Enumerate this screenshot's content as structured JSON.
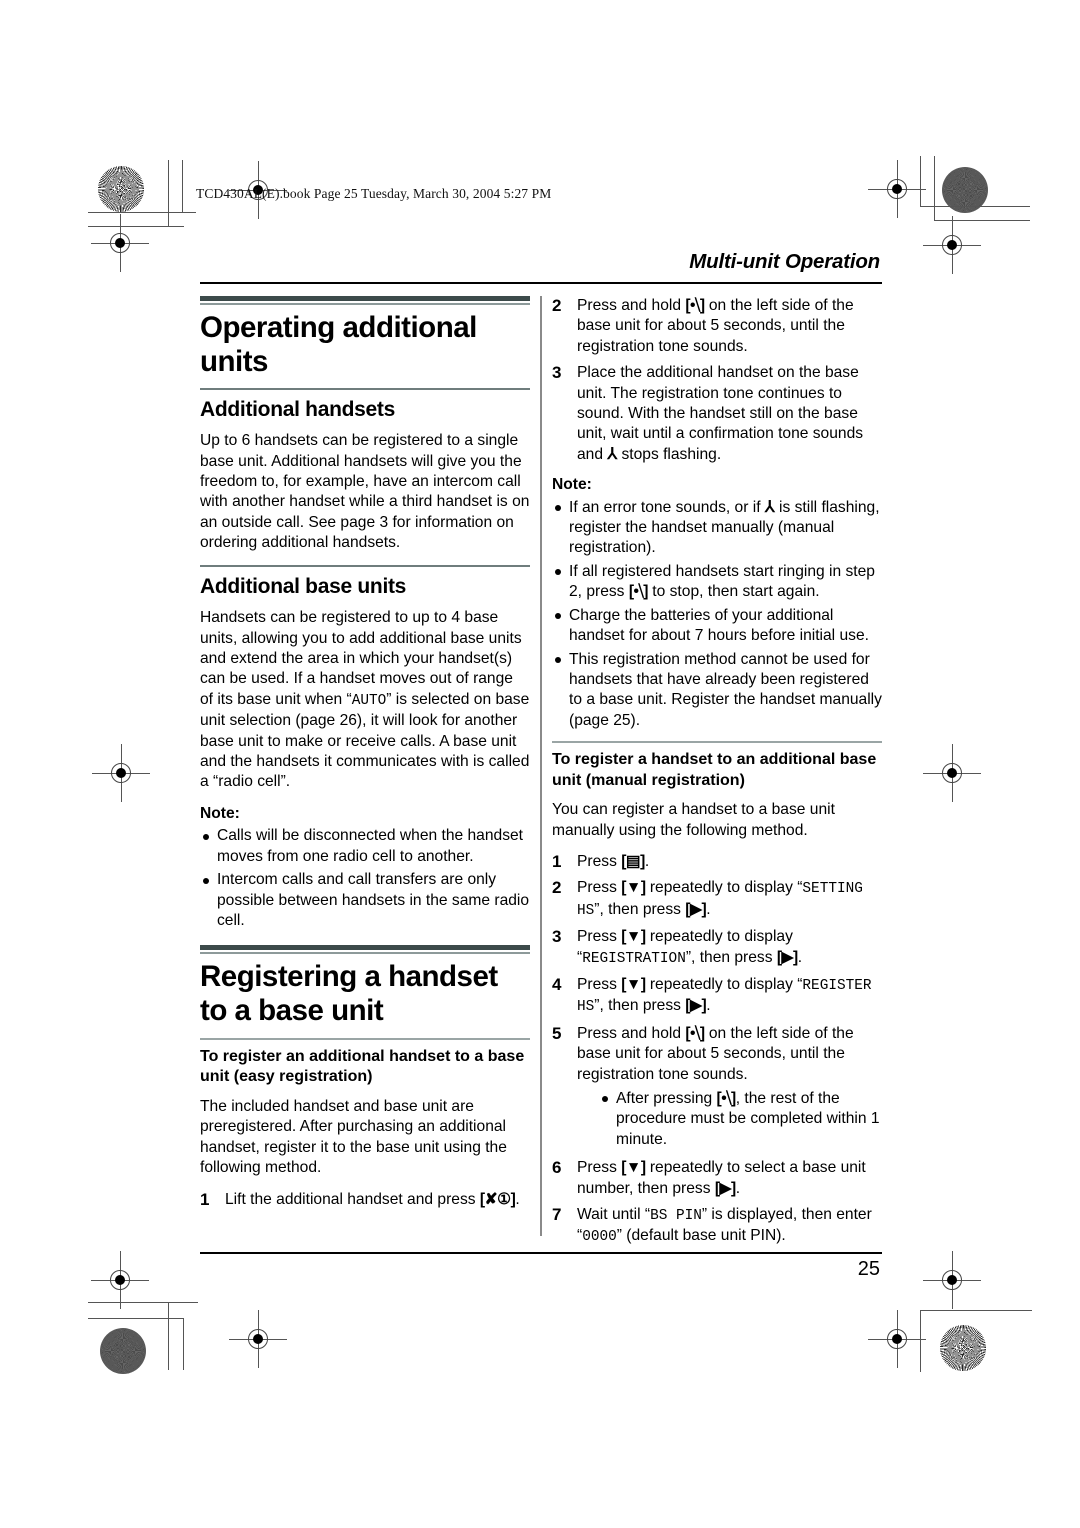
{
  "printmark": {
    "filestamp": "TCD430AL(E).book  Page 25  Tuesday, March 30, 2004  5:27 PM"
  },
  "header": {
    "running_head": "Multi-unit Operation"
  },
  "footer": {
    "page_number": "25"
  },
  "left_column": {
    "chapter_title": "Operating additional units",
    "section1": {
      "heading": "Additional handsets",
      "body": "Up to 6 handsets can be registered to a single base unit. Additional handsets will give you the freedom to, for example, have an intercom call with another handset while a third handset is on an outside call. See page 3 for information on ordering additional handsets."
    },
    "section2": {
      "heading": "Additional base units",
      "body_part1": "Handsets can be registered to up to 4 base units, allowing you to add additional base units and extend the area in which your handset(s) can be used. If a handset moves out of range of its base unit when “",
      "body_mono": "AUTO",
      "body_part2": "” is selected on base unit selection (page 26), it will look for another base unit to make or receive calls. A base unit and the handsets it communicates with is called a “radio cell”.",
      "note_label": "Note:",
      "notes": [
        "Calls will be disconnected when the handset moves from one radio cell to another.",
        "Intercom calls and call transfers are only possible between handsets in the same radio cell."
      ]
    },
    "section3": {
      "chapter_title": "Registering a handset to a base unit",
      "heading": "To register an additional handset to a base unit (easy registration)",
      "body": "The included handset and base unit are preregistered. After purchasing an additional handset, register it to the base unit using the following method.",
      "step1_num": "1",
      "step1_text_before": "Lift the additional handset and press ",
      "step1_key": "[✘①]",
      "step1_text_after": "."
    }
  },
  "right_column": {
    "steps_easy": [
      {
        "num": "2",
        "text_before": "Press and hold ",
        "key": "[•⧹]",
        "text_after": " on the left side of the base unit for about 5 seconds, until the registration tone sounds."
      },
      {
        "num": "3",
        "text_before": "Place the additional handset on the base unit. The registration tone continues to sound. With the handset still on the base unit, wait until a confirmation tone sounds and ",
        "key": "⅄",
        "text_after": " stops flashing."
      }
    ],
    "note_label": "Note:",
    "notes": [
      {
        "before": "If an error tone sounds, or if ",
        "key": "⅄",
        "after": " is still flashing, register the handset manually (manual registration)."
      },
      {
        "before": "If all registered handsets start ringing in step 2, press ",
        "key": "[•⧹]",
        "after": " to stop, then start again."
      },
      {
        "before": "Charge the batteries of your additional handset for about 7 hours before initial use.",
        "key": "",
        "after": ""
      },
      {
        "before": "This registration method cannot be used for handsets that have already been registered to a base unit. Register the handset manually (page 25).",
        "key": "",
        "after": ""
      }
    ],
    "manual_section": {
      "heading": "To register a handset to an additional base unit (manual registration)",
      "body": "You can register a handset to a base unit manually using the following method.",
      "steps": [
        {
          "num": "1",
          "before": "Press ",
          "key": "[▤]",
          "mono": "",
          "mid": "",
          "key2": "",
          "after": "."
        },
        {
          "num": "2",
          "before": "Press ",
          "key": "[▼]",
          "mid": " repeatedly to display “",
          "mono": "SETTING HS",
          "mid2": "”, then press ",
          "key2": "[▶]",
          "after": "."
        },
        {
          "num": "3",
          "before": "Press ",
          "key": "[▼]",
          "mid": " repeatedly to display “",
          "mono": "REGISTRATION",
          "mid2": "”, then press ",
          "key2": "[▶]",
          "after": "."
        },
        {
          "num": "4",
          "before": "Press ",
          "key": "[▼]",
          "mid": " repeatedly to display “",
          "mono": "REGISTER HS",
          "mid2": "”, then press ",
          "key2": "[▶]",
          "after": "."
        },
        {
          "num": "5",
          "before": "Press and hold ",
          "key": "[•⧹]",
          "mid": " on the left side of the base unit for about 5 seconds, until the registration tone sounds.",
          "mono": "",
          "mid2": "",
          "key2": "",
          "after": ""
        },
        {
          "num": "6",
          "before": "Press ",
          "key": "[▼]",
          "mid": " repeatedly to select a base unit number, then press ",
          "mono": "",
          "mid2": "",
          "key2": "[▶]",
          "after": "."
        },
        {
          "num": "7",
          "before": "Wait until “",
          "key": "",
          "mono": "BS PIN",
          "mid2": "” is displayed, then enter “",
          "mono2": "0000",
          "key2": "",
          "after": "” (default base unit PIN)."
        }
      ],
      "step5_subnote": {
        "before": "After pressing ",
        "key": "[•⧹]",
        "after": ", the rest of the procedure must be completed within 1 minute."
      }
    }
  }
}
